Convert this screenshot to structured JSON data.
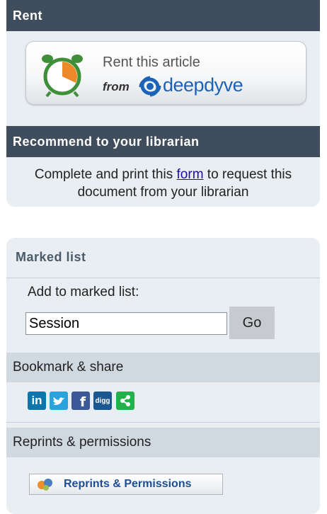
{
  "rent": {
    "header": "Rent",
    "button_line1": "Rent this article",
    "button_from": "from",
    "brand": "deepdyve"
  },
  "recommend": {
    "header": "Recommend to your librarian",
    "text_before": "Complete and print this ",
    "link": "form",
    "text_after": " to request this document from your librarian"
  },
  "marked_list": {
    "title": "Marked list",
    "add_label": "Add to marked list:",
    "selected": "Session",
    "go_label": "Go"
  },
  "bookmark": {
    "header": "Bookmark & share",
    "icons": [
      {
        "name": "linkedin-icon",
        "glyph": "in",
        "color": "#0e76a8"
      },
      {
        "name": "twitter-icon",
        "glyph": "",
        "color": "#2aa3dd"
      },
      {
        "name": "facebook-icon",
        "glyph": "f",
        "color": "#3b5998"
      },
      {
        "name": "digg-icon",
        "glyph": "digg",
        "color": "#1b5891"
      },
      {
        "name": "share-icon",
        "glyph": "",
        "color": "#22b14c"
      }
    ]
  },
  "reprints": {
    "header": "Reprints & permissions",
    "button_label": "Reprints & Permissions"
  },
  "colors": {
    "panel_bg": "#e9eef2",
    "dark_header": "#3f4d5c",
    "section_header": "#d1d9e0",
    "link": "#1a0dab",
    "deepdyve_blue": "#1c63b7"
  }
}
